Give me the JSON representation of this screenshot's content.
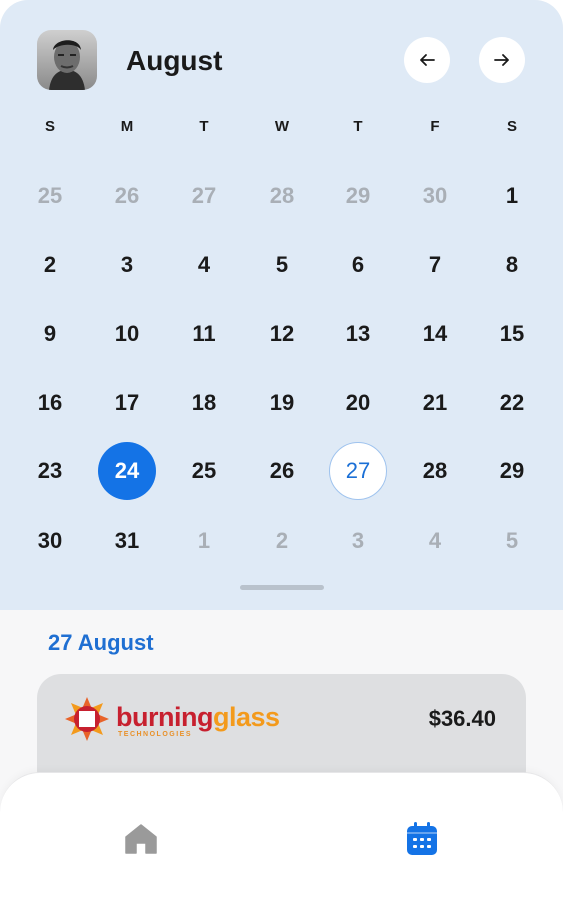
{
  "header": {
    "month": "August",
    "avatar_icon": "user-avatar-photo",
    "prev_icon": "arrow-left-icon",
    "next_icon": "arrow-right-icon"
  },
  "weekdays": [
    "S",
    "M",
    "T",
    "W",
    "T",
    "F",
    "S"
  ],
  "weeks": [
    [
      {
        "d": "25",
        "muted": true
      },
      {
        "d": "26",
        "muted": true
      },
      {
        "d": "27",
        "muted": true
      },
      {
        "d": "28",
        "muted": true
      },
      {
        "d": "29",
        "muted": true
      },
      {
        "d": "30",
        "muted": true
      },
      {
        "d": "1"
      }
    ],
    [
      {
        "d": "2"
      },
      {
        "d": "3"
      },
      {
        "d": "4"
      },
      {
        "d": "5"
      },
      {
        "d": "6"
      },
      {
        "d": "7"
      },
      {
        "d": "8"
      }
    ],
    [
      {
        "d": "9"
      },
      {
        "d": "10"
      },
      {
        "d": "11"
      },
      {
        "d": "12"
      },
      {
        "d": "13"
      },
      {
        "d": "14"
      },
      {
        "d": "15"
      }
    ],
    [
      {
        "d": "16"
      },
      {
        "d": "17"
      },
      {
        "d": "18"
      },
      {
        "d": "19"
      },
      {
        "d": "20"
      },
      {
        "d": "21"
      },
      {
        "d": "22"
      }
    ],
    [
      {
        "d": "23"
      },
      {
        "d": "24",
        "state": "selected"
      },
      {
        "d": "25"
      },
      {
        "d": "26"
      },
      {
        "d": "27",
        "state": "today"
      },
      {
        "d": "28"
      },
      {
        "d": "29"
      }
    ],
    [
      {
        "d": "30"
      },
      {
        "d": "31"
      },
      {
        "d": "1",
        "muted": true
      },
      {
        "d": "2",
        "muted": true
      },
      {
        "d": "3",
        "muted": true
      },
      {
        "d": "4",
        "muted": true
      },
      {
        "d": "5",
        "muted": true
      }
    ]
  ],
  "section": {
    "date_heading": "27 August"
  },
  "transactions": [
    {
      "merchant_logo_word_1": "burning",
      "merchant_logo_word_2": "glass",
      "merchant_logo_sub": "TECHNOLOGIES",
      "amount": "$36.40"
    }
  ],
  "bottom_nav": {
    "home_icon": "home-icon",
    "calendar_icon": "calendar-icon",
    "active": "calendar"
  },
  "colors": {
    "calendar_bg": "#dfeaf6",
    "accent": "#1473e6",
    "heading_blue": "#1f6fd2",
    "muted_day": "#a9afb6",
    "inactive_icon": "#9a9a9a"
  }
}
